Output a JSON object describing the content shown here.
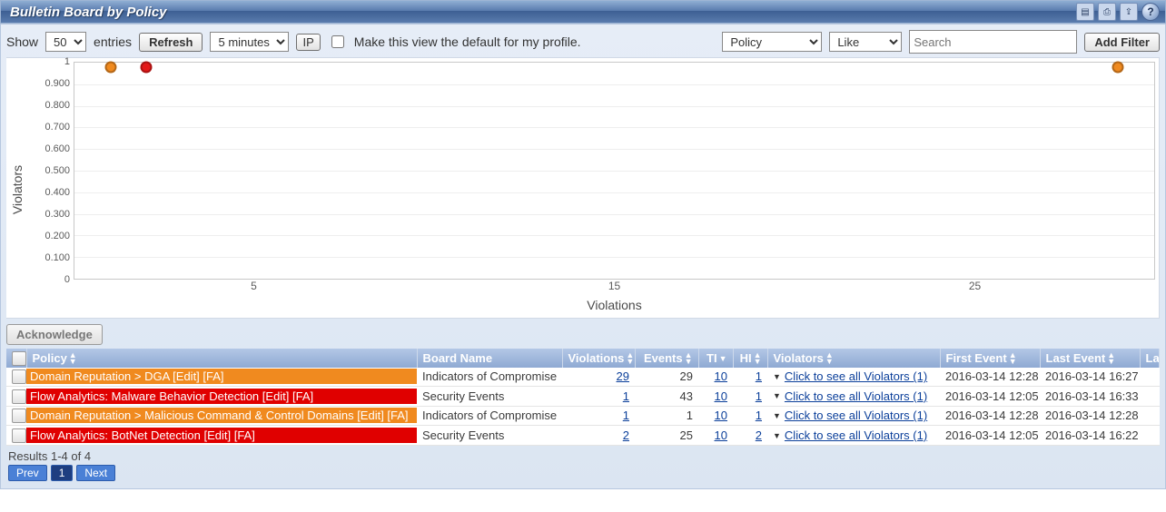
{
  "titlebar": {
    "title": "Bulletin Board by Policy",
    "icons": [
      "pdf-icon",
      "print-icon",
      "export-icon",
      "help-icon"
    ],
    "help_label": "?"
  },
  "toolbar": {
    "show_label": "Show",
    "show_options": [
      "50"
    ],
    "show_value": "50",
    "entries_label": "entries",
    "refresh_label": "Refresh",
    "interval_options": [
      "5 minutes"
    ],
    "interval_value": "5 minutes",
    "ip_label": "IP",
    "default_label": "Make this view the default for my profile.",
    "filter_field_options": [
      "Policy"
    ],
    "filter_field_value": "Policy",
    "filter_op_options": [
      "Like"
    ],
    "filter_op_value": "Like",
    "search_placeholder": "Search",
    "add_filter_label": "Add Filter"
  },
  "chart_data": {
    "type": "scatter",
    "xlabel": "Violations",
    "ylabel": "Violators",
    "ylim": [
      0,
      1
    ],
    "yticks": [
      1,
      0.9,
      0.8,
      0.7,
      0.6,
      0.5,
      0.4,
      0.3,
      0.2,
      0.1,
      0
    ],
    "xticks": [
      5,
      15,
      25
    ],
    "x_range": [
      0,
      30
    ],
    "series": [
      {
        "name": "orange-a",
        "color": "#f08a1f",
        "x": 1,
        "y": 1
      },
      {
        "name": "red-a",
        "color": "#e31818",
        "x": 2,
        "y": 1
      },
      {
        "name": "orange-b",
        "color": "#f08a1f",
        "x": 29,
        "y": 1
      }
    ]
  },
  "acknowledge_label": "Acknowledge",
  "columns": {
    "policy": "Policy",
    "board": "Board Name",
    "violations": "Violations",
    "events": "Events",
    "ti": "TI",
    "hi": "HI",
    "violators": "Violators",
    "first_event": "First Event",
    "last_event": "Last Event",
    "last": "Las"
  },
  "rows": [
    {
      "color": "#f08a1f",
      "policy_text": "Domain Reputation > DGA",
      "policy_edit": "[Edit]",
      "policy_fa": "[FA]",
      "board": "Indicators of Compromise",
      "violations": "29",
      "events": "29",
      "ti": "10",
      "hi": "1",
      "violators": "Click to see all Violators (1)",
      "first_event": "2016-03-14 12:28",
      "last_event": "2016-03-14 16:27"
    },
    {
      "color": "#e00000",
      "policy_text": "Flow Analytics: Malware Behavior Detection",
      "policy_edit": "[Edit]",
      "policy_fa": "[FA]",
      "board": "Security Events",
      "violations": "1",
      "events": "43",
      "ti": "10",
      "hi": "1",
      "violators": "Click to see all Violators (1)",
      "first_event": "2016-03-14 12:05",
      "last_event": "2016-03-14 16:33"
    },
    {
      "color": "#f08a1f",
      "policy_text": "Domain Reputation > Malicious Command & Control Domains",
      "policy_edit": "[Edit]",
      "policy_fa": "[FA]",
      "board": "Indicators of Compromise",
      "violations": "1",
      "events": "1",
      "ti": "10",
      "hi": "1",
      "violators": "Click to see all Violators (1)",
      "first_event": "2016-03-14 12:28",
      "last_event": "2016-03-14 12:28"
    },
    {
      "color": "#e00000",
      "policy_text": "Flow Analytics: BotNet Detection",
      "policy_edit": "[Edit]",
      "policy_fa": "[FA]",
      "board": "Security Events",
      "violations": "2",
      "events": "25",
      "ti": "10",
      "hi": "2",
      "violators": "Click to see all Violators (1)",
      "first_event": "2016-03-14 12:05",
      "last_event": "2016-03-14 16:22"
    }
  ],
  "footer": {
    "results_text": "Results 1-4 of 4",
    "prev": "Prev",
    "page": "1",
    "next": "Next"
  }
}
